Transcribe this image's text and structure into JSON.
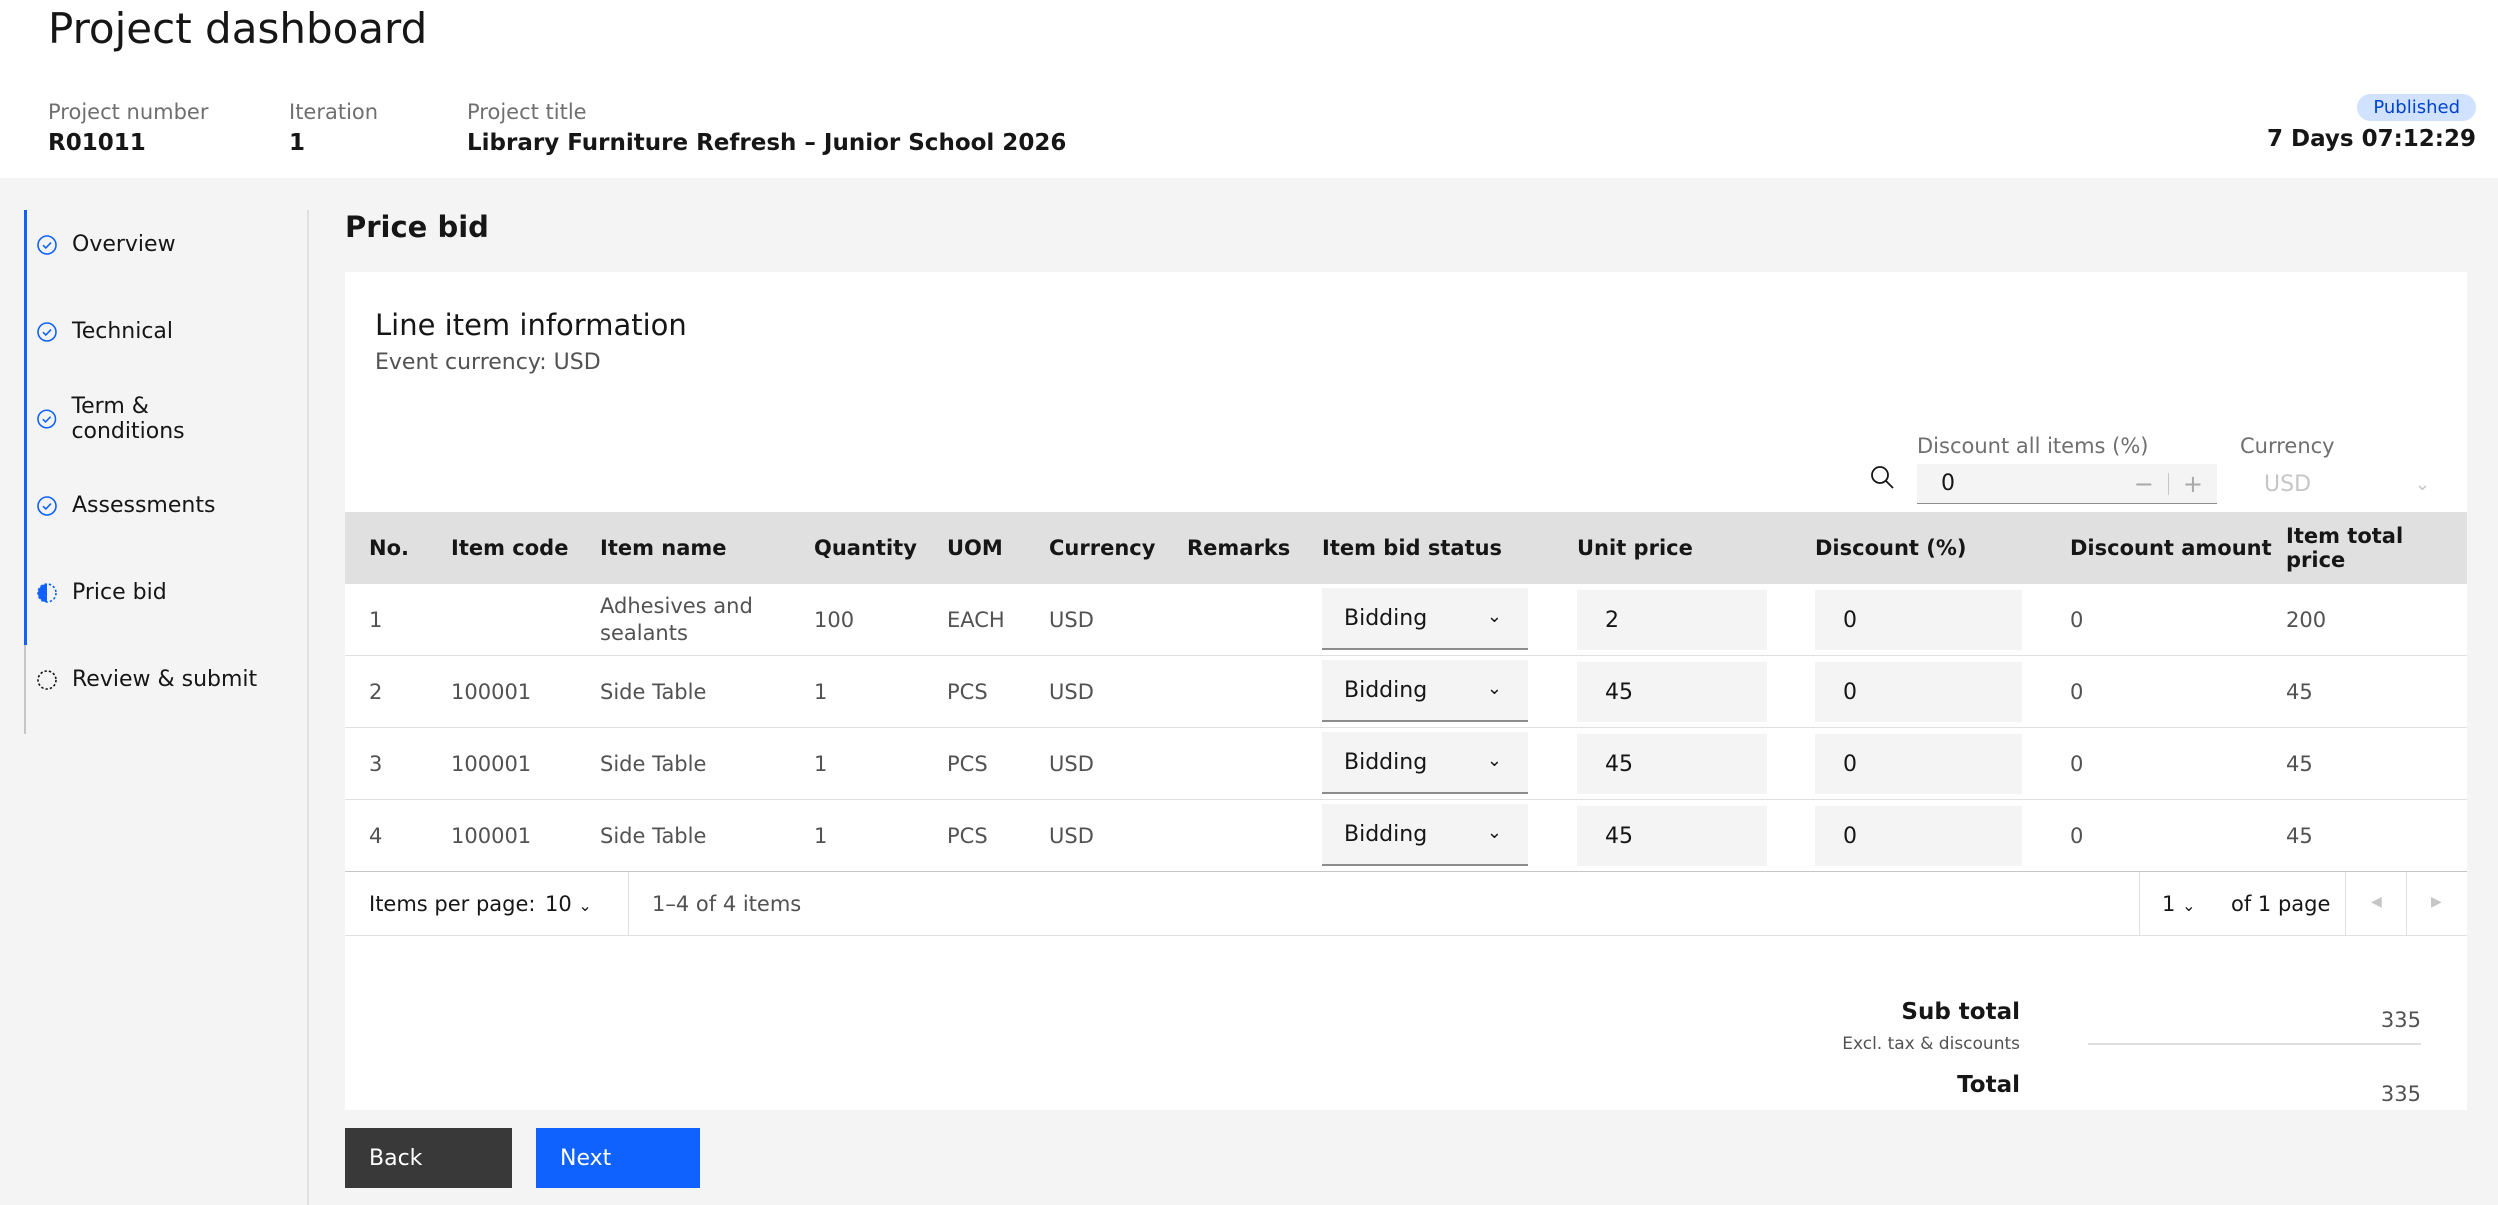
{
  "header": {
    "title": "Project dashboard",
    "project_number_label": "Project number",
    "project_number": "R01011",
    "iteration_label": "Iteration",
    "iteration": "1",
    "project_title_label": "Project title",
    "project_title": "Library Furniture Refresh – Junior School 2026",
    "status_badge": "Published",
    "countdown": "7 Days 07:12:29"
  },
  "sidebar": {
    "items": [
      {
        "label": "Overview",
        "icon": "check-circle-icon",
        "state": "complete"
      },
      {
        "label": "Technical",
        "icon": "check-circle-icon",
        "state": "complete"
      },
      {
        "label": "Term & conditions",
        "icon": "check-circle-icon",
        "state": "complete"
      },
      {
        "label": "Assessments",
        "icon": "check-circle-icon",
        "state": "complete"
      },
      {
        "label": "Price bid",
        "icon": "half-circle-icon",
        "state": "current"
      },
      {
        "label": "Review & submit",
        "icon": "dashed-circle-icon",
        "state": "incomplete"
      }
    ]
  },
  "main": {
    "section_title": "Price bid",
    "card_title": "Line item information",
    "card_subtitle": "Event currency: USD",
    "discount_all_label": "Discount all items (%)",
    "discount_all_value": "0",
    "currency_label": "Currency",
    "currency_value": "USD"
  },
  "table": {
    "headers": [
      "No.",
      "Item code",
      "Item name",
      "Quantity",
      "UOM",
      "Currency",
      "Remarks",
      "Item bid status",
      "Unit price",
      "Discount (%)",
      "Discount amount",
      "Item total price"
    ],
    "rows": [
      {
        "no": "1",
        "code": "",
        "name": "Adhesives and sealants",
        "qty": "100",
        "uom": "EACH",
        "currency": "USD",
        "remarks": "",
        "status": "Bidding",
        "unit_price": "2",
        "discount_pct": "0",
        "discount_amt": "0",
        "total": "200"
      },
      {
        "no": "2",
        "code": "100001",
        "name": "Side Table",
        "qty": "1",
        "uom": "PCS",
        "currency": "USD",
        "remarks": "",
        "status": "Bidding",
        "unit_price": "45",
        "discount_pct": "0",
        "discount_amt": "0",
        "total": "45"
      },
      {
        "no": "3",
        "code": "100001",
        "name": "Side Table",
        "qty": "1",
        "uom": "PCS",
        "currency": "USD",
        "remarks": "",
        "status": "Bidding",
        "unit_price": "45",
        "discount_pct": "0",
        "discount_amt": "0",
        "total": "45"
      },
      {
        "no": "4",
        "code": "100001",
        "name": "Side Table",
        "qty": "1",
        "uom": "PCS",
        "currency": "USD",
        "remarks": "",
        "status": "Bidding",
        "unit_price": "45",
        "discount_pct": "0",
        "discount_amt": "0",
        "total": "45"
      }
    ]
  },
  "pagination": {
    "items_per_page_label": "Items per page:",
    "items_per_page": "10",
    "range": "1–4 of 4 items",
    "page": "1",
    "of_pages": "of 1 page"
  },
  "totals": {
    "subtotal_label": "Sub total",
    "subtotal_note": "Excl. tax & discounts",
    "subtotal_value": "335",
    "total_label": "Total",
    "total_value": "335"
  },
  "actions": {
    "back_label": "Back",
    "next_label": "Next"
  },
  "colors": {
    "accent": "#0f62fe",
    "badge_bg": "#d0e2ff",
    "badge_text": "#0043ce",
    "back_button": "#393939"
  }
}
